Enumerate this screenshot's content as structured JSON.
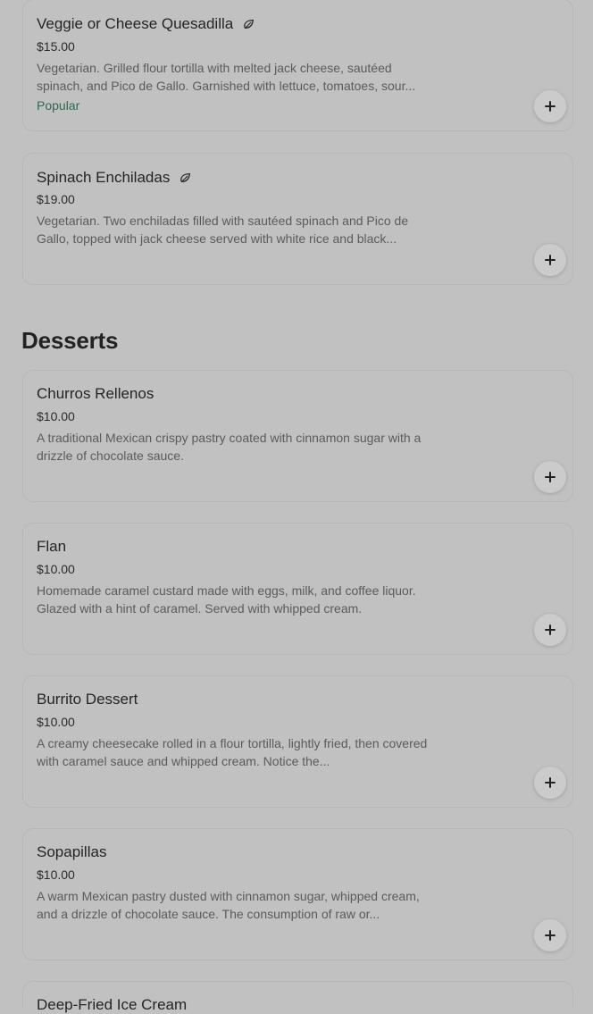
{
  "menu": {
    "section_title": "Desserts",
    "items": [
      {
        "name": "Veggie or Cheese Quesadilla",
        "price": "$15.00",
        "description": "Vegetarian. Grilled flour tortilla with melted jack cheese, sautéed spinach, and Pico de Gallo. Garnished with lettuce, tomatoes, sour...",
        "badge": "Popular",
        "icon": "leaf-icon",
        "add_icon": "plus-icon"
      },
      {
        "name": "Spinach Enchiladas",
        "price": "$19.00",
        "description": "Vegetarian. Two enchiladas filled with sautéed spinach and Pico de Gallo, topped with jack cheese served with white rice and black...",
        "icon": "leaf-icon",
        "add_icon": "plus-icon"
      },
      {
        "name": "Churros Rellenos",
        "price": "$10.00",
        "description": "A traditional Mexican crispy pastry coated with cinnamon sugar with a drizzle of chocolate sauce.",
        "add_icon": "plus-icon"
      },
      {
        "name": "Flan",
        "price": "$10.00",
        "description": "Homemade caramel custard made with eggs, milk, and coffee liquor. Glazed with a hint of caramel. Served with whipped cream.",
        "add_icon": "plus-icon"
      },
      {
        "name": "Burrito Dessert",
        "price": "$10.00",
        "description": "A creamy cheesecake rolled in a flour tortilla, lightly fried, then covered with caramel sauce and whipped cream. Notice the...",
        "add_icon": "plus-icon"
      },
      {
        "name": "Sopapillas",
        "price": "$10.00",
        "description": "A warm Mexican pastry dusted with cinnamon sugar, whipped cream, and a drizzle of chocolate sauce. The consumption of raw or...",
        "add_icon": "plus-icon"
      },
      {
        "name": "Deep-Fried Ice Cream"
      }
    ]
  },
  "colors": {
    "background": "#c1c1c1",
    "card_border": "#b7b7b7",
    "popular_text": "#2f6a51"
  }
}
